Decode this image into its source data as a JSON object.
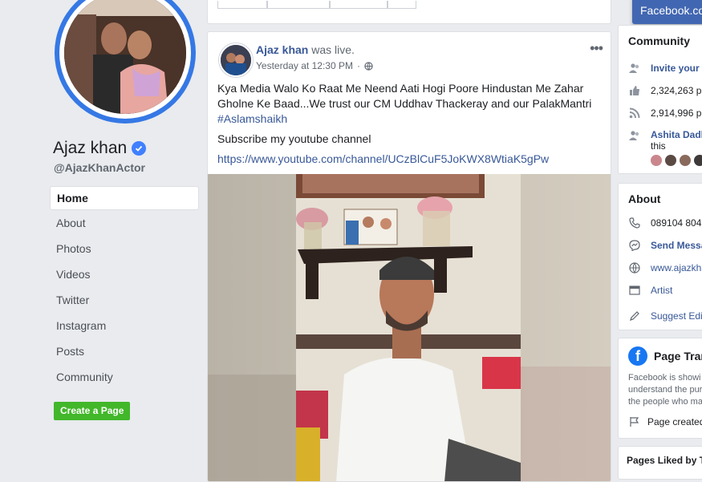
{
  "page": {
    "name": "Ajaz khan",
    "handle": "@AjazKhanActor"
  },
  "nav": {
    "items": [
      "Home",
      "About",
      "Photos",
      "Videos",
      "Twitter",
      "Instagram",
      "Posts",
      "Community"
    ],
    "active": "Home",
    "create_page": "Create a Page"
  },
  "post": {
    "author": "Ajaz khan",
    "action": "was live.",
    "time": "Yesterday at 12:30 PM",
    "text_line1": "Kya Media Walo Ko Raat Me Neend Aati Hogi Poore Hindustan Me Zahar",
    "text_line2": "Gholne Ke Baad...We trust our CM Uddhav Thackeray and our PalakMantri",
    "hashtag": "#Aslamshaikh",
    "subscribe": "Subscribe my youtube channel",
    "link": "https://www.youtube.com/channel/UCzBlCuF5JoKWX8WtiaK5gPw",
    "more": "•••"
  },
  "community": {
    "title": "Community",
    "invite": "Invite your",
    "likes": "2,324,263 p",
    "follows": "2,914,996 p",
    "friend": "Ashita Dadl",
    "friend_suffix": "this"
  },
  "about": {
    "title": "About",
    "phone": "089104 804",
    "send": "Send Messa",
    "website": "www.ajazkha",
    "category": "Artist",
    "suggest": "Suggest Edi"
  },
  "transparency": {
    "title": "Page Tran",
    "desc_line1": "Facebook is showi",
    "desc_line2": "understand the pur",
    "desc_line3": "the people who ma",
    "created": "Page created"
  },
  "pages_liked": "Pages Liked by T",
  "chat_tab": "Facebook.co",
  "colors": {
    "brand": "#4267b2",
    "link": "#385898",
    "green": "#42b72a",
    "verified": "#4080ff"
  }
}
